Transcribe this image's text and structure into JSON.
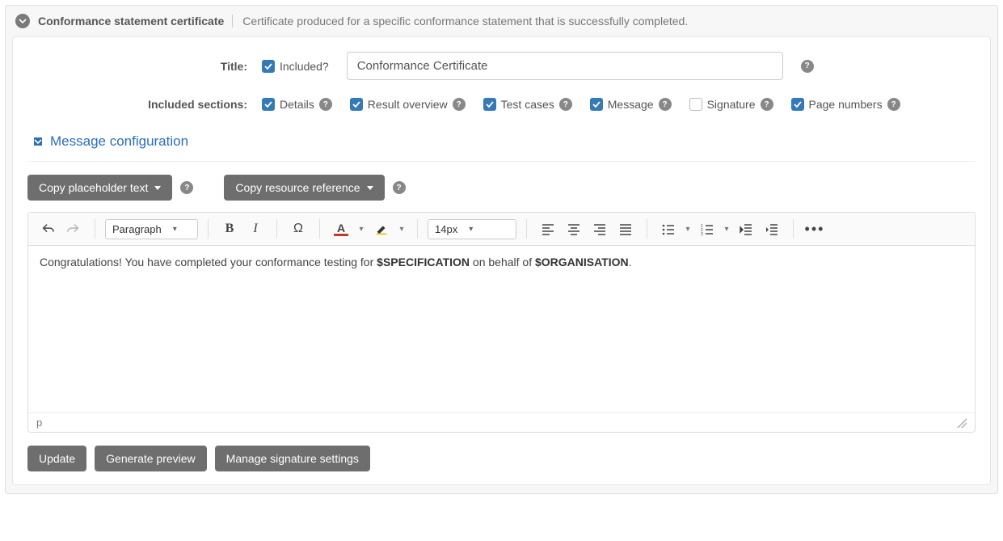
{
  "panel": {
    "title": "Conformance statement certificate",
    "subtitle": "Certificate produced for a specific conformance statement that is successfully completed."
  },
  "form": {
    "title_label": "Title:",
    "included_label": "Included?",
    "title_value": "Conformance Certificate",
    "sections_label": "Included sections:",
    "sections": {
      "details": "Details",
      "result_overview": "Result overview",
      "test_cases": "Test cases",
      "message": "Message",
      "signature": "Signature",
      "page_numbers": "Page numbers"
    }
  },
  "message_section": {
    "heading": "Message configuration",
    "copy_placeholder_btn": "Copy placeholder text",
    "copy_resource_btn": "Copy resource reference"
  },
  "editor": {
    "paragraph_select": "Paragraph",
    "font_size_select": "14px",
    "content_prefix": "Congratulations! You have completed your conformance testing for ",
    "content_spec": "$SPECIFICATION",
    "content_mid": " on behalf of ",
    "content_org": "$ORGANISATION",
    "content_suffix": ".",
    "path": "p"
  },
  "footer": {
    "update": "Update",
    "preview": "Generate preview",
    "signature_settings": "Manage signature settings"
  }
}
